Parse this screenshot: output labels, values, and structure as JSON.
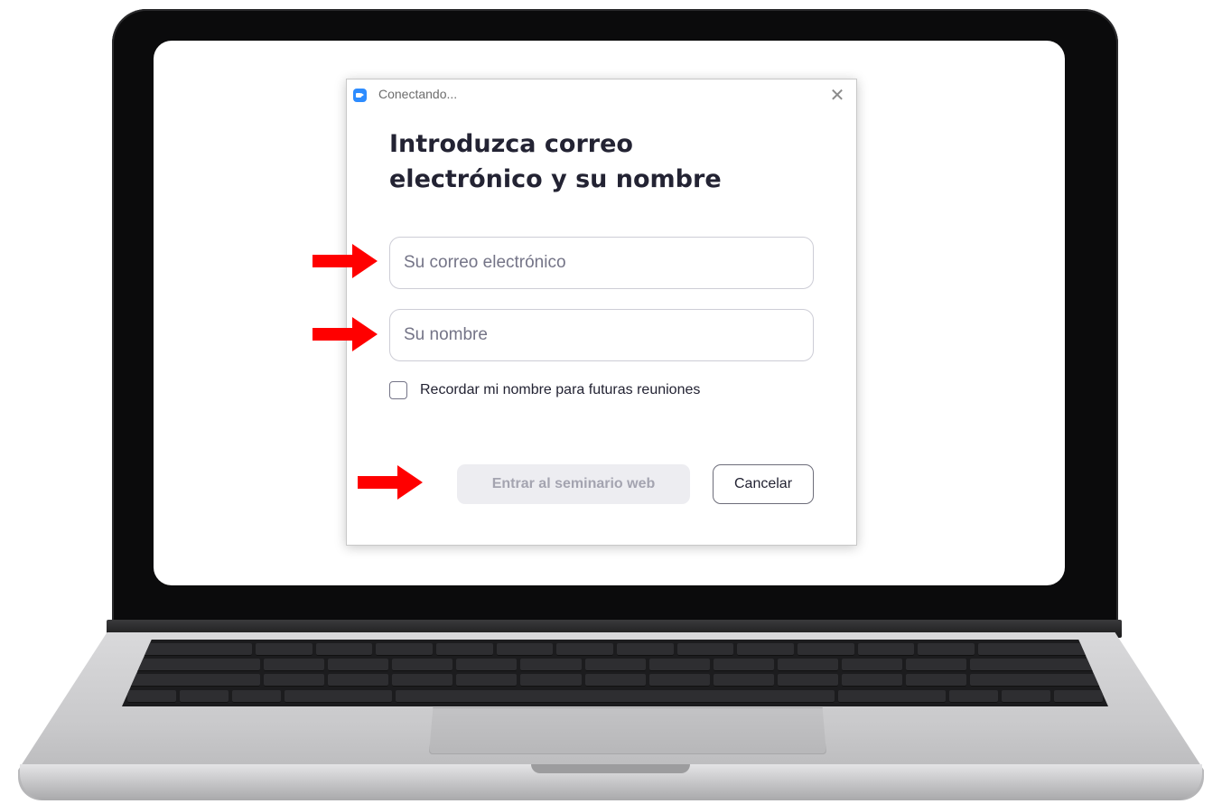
{
  "window": {
    "title": "Conectando..."
  },
  "dialog": {
    "heading_line1": "Introduzca correo",
    "heading_line2": "electrónico y su nombre",
    "email": {
      "value": "",
      "placeholder": "Su correo electrónico"
    },
    "name": {
      "value": "",
      "placeholder": "Su nombre"
    },
    "remember": {
      "label": "Recordar mi nombre para futuras reuniones",
      "checked": false
    },
    "join_label": "Entrar al seminario web",
    "cancel_label": "Cancelar"
  },
  "icons": {
    "app": "zoom-camera-icon",
    "close": "close-icon",
    "annotation": "red-arrow-icon"
  },
  "colors": {
    "accent": "#2d8cff",
    "arrow": "#ff0000",
    "heading": "#232333",
    "join_disabled_bg": "#ededf1",
    "join_disabled_text": "#a4a4b0"
  }
}
